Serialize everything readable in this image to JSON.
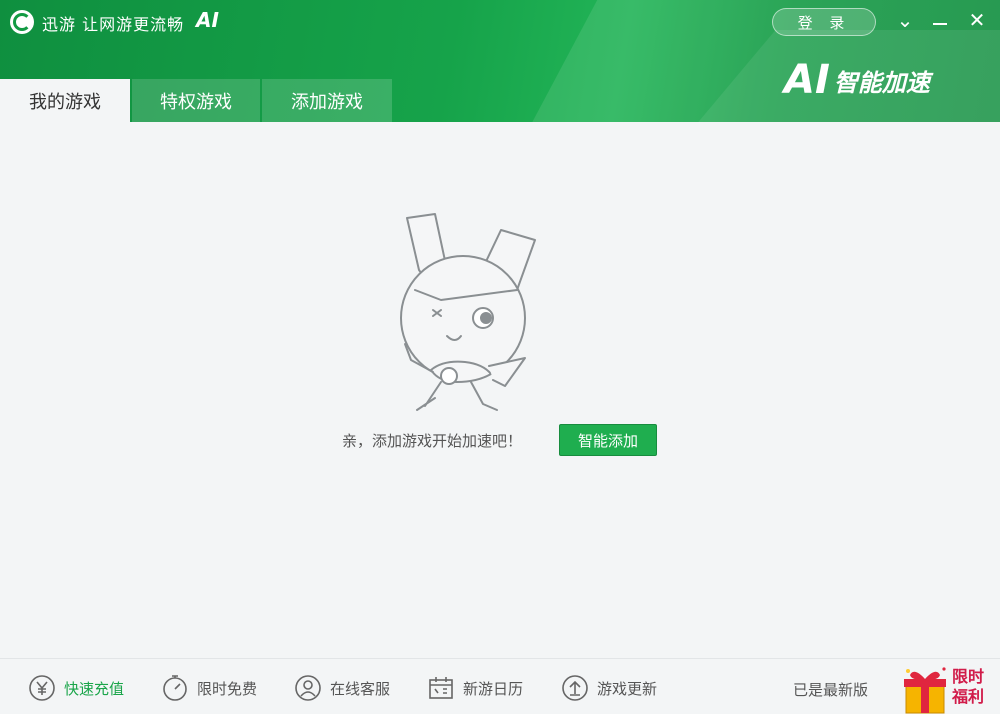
{
  "window": {
    "title": "迅游 让网游更流畅",
    "title_ai": "AI",
    "login_label": "登 录",
    "minimize_icon": "minimize-icon",
    "chevron_icon": "chevron-down-icon",
    "close_icon": "close-icon",
    "close_glyph": "✕",
    "chevron_glyph": "⌄"
  },
  "brand": {
    "ai": "AI",
    "text": "智能加速"
  },
  "tabs": [
    {
      "label": "我的游戏",
      "active": true
    },
    {
      "label": "特权游戏",
      "active": false
    },
    {
      "label": "添加游戏",
      "active": false
    }
  ],
  "main": {
    "prompt": "亲，添加游戏开始加速吧！",
    "button_label": "智能添加"
  },
  "footer": {
    "items": [
      {
        "label": "快速充值",
        "icon": "yen-icon"
      },
      {
        "label": "限时免费",
        "icon": "stopwatch-icon"
      },
      {
        "label": "在线客服",
        "icon": "user-icon"
      },
      {
        "label": "新游日历",
        "icon": "calendar-icon"
      },
      {
        "label": "游戏更新",
        "icon": "upload-icon"
      }
    ],
    "version": "已是最新版",
    "promo": {
      "line1": "限时",
      "line2": "福利"
    }
  },
  "colors": {
    "brand_green": "#16a34a",
    "button_green": "#1fae4f",
    "promo_red": "#d11c4a"
  }
}
